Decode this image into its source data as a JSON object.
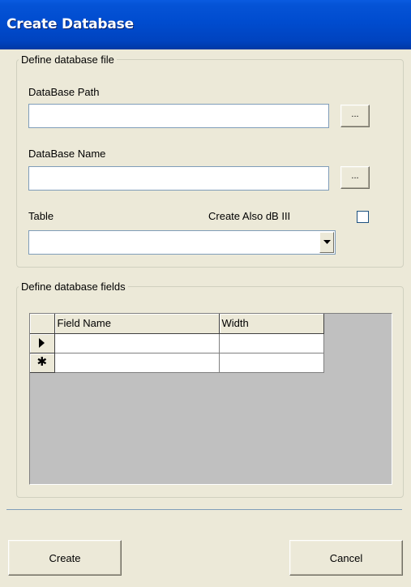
{
  "window": {
    "title": "Create Database"
  },
  "file_group": {
    "legend": "Define database file",
    "path_label": "DataBase Path",
    "path_value": "",
    "path_browse_label": "...",
    "name_label": "DataBase Name",
    "name_value": "",
    "name_browse_label": "...",
    "table_label": "Table",
    "table_value": "",
    "create_dbiii_label": "Create Also dB III",
    "create_dbiii_checked": false
  },
  "fields_group": {
    "legend": "Define database fields",
    "columns": [
      "Field Name",
      "Width"
    ],
    "rows": [
      {
        "indicator": "current-row-arrow",
        "field_name": "",
        "width": ""
      },
      {
        "indicator": "new-row-asterisk",
        "field_name": "",
        "width": ""
      }
    ],
    "new_row_glyph": "✱"
  },
  "footer": {
    "create_label": "Create",
    "cancel_label": "Cancel"
  },
  "colors": {
    "titlebar": "#0054E3",
    "window_bg": "#ECE9D8",
    "grid_bg": "#C0C0C0",
    "field_border": "#7F9DB9"
  }
}
